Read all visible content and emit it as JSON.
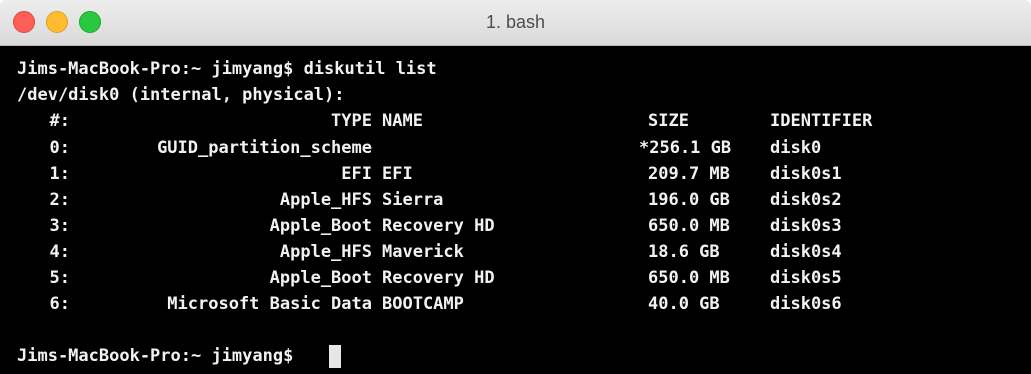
{
  "window": {
    "title": "1. bash"
  },
  "terminal": {
    "prompt": "Jims-MacBook-Pro:~ jimyang$ ",
    "command": "diskutil list",
    "disk_line": "/dev/disk0 (internal, physical):",
    "columns": {
      "num": "#:",
      "type": "TYPE",
      "name": "NAME",
      "size": "SIZE",
      "identifier": "IDENTIFIER"
    },
    "rows": [
      {
        "num": "0:",
        "type": "GUID_partition_scheme",
        "name": "",
        "size": "*256.1 GB",
        "identifier": "disk0"
      },
      {
        "num": "1:",
        "type": "EFI",
        "name": "EFI",
        "size": "209.7 MB",
        "identifier": "disk0s1"
      },
      {
        "num": "2:",
        "type": "Apple_HFS",
        "name": "Sierra",
        "size": "196.0 GB",
        "identifier": "disk0s2"
      },
      {
        "num": "3:",
        "type": "Apple_Boot",
        "name": "Recovery HD",
        "size": "650.0 MB",
        "identifier": "disk0s3"
      },
      {
        "num": "4:",
        "type": "Apple_HFS",
        "name": "Maverick",
        "size": "18.6 GB",
        "identifier": "disk0s4"
      },
      {
        "num": "5:",
        "type": "Apple_Boot",
        "name": "Recovery HD",
        "size": "650.0 MB",
        "identifier": "disk0s5"
      },
      {
        "num": "6:",
        "type": "Microsoft Basic Data",
        "name": "BOOTCAMP",
        "size": "40.0 GB",
        "identifier": "disk0s6"
      }
    ],
    "final_prompt": "Jims-MacBook-Pro:~ jimyang$"
  }
}
